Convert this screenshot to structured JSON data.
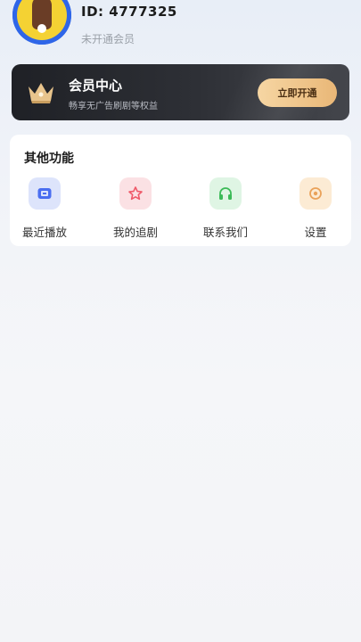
{
  "profile": {
    "user_id": "ID:  4777325",
    "member_status": "未开通会员"
  },
  "vip": {
    "title": "会员中心",
    "subtitle": "畅享无广告刷剧等权益",
    "button_label": "立即开通",
    "colors": {
      "banner": "#1f2126",
      "button_start": "#f6d6a3",
      "button_end": "#e9b777"
    }
  },
  "functions": {
    "title": "其他功能",
    "items": [
      {
        "label": "最近播放",
        "icon": "play-history-icon",
        "bg": "#dde4fb",
        "color": "#4a6ef0"
      },
      {
        "label": "我的追剧",
        "icon": "star-icon",
        "bg": "#fbe1e4",
        "color": "#ef5a6a"
      },
      {
        "label": "联系我们",
        "icon": "headset-icon",
        "bg": "#dff5e4",
        "color": "#3cba58"
      },
      {
        "label": "设置",
        "icon": "gear-icon",
        "bg": "#fcebd4",
        "color": "#eaa25a"
      }
    ]
  }
}
